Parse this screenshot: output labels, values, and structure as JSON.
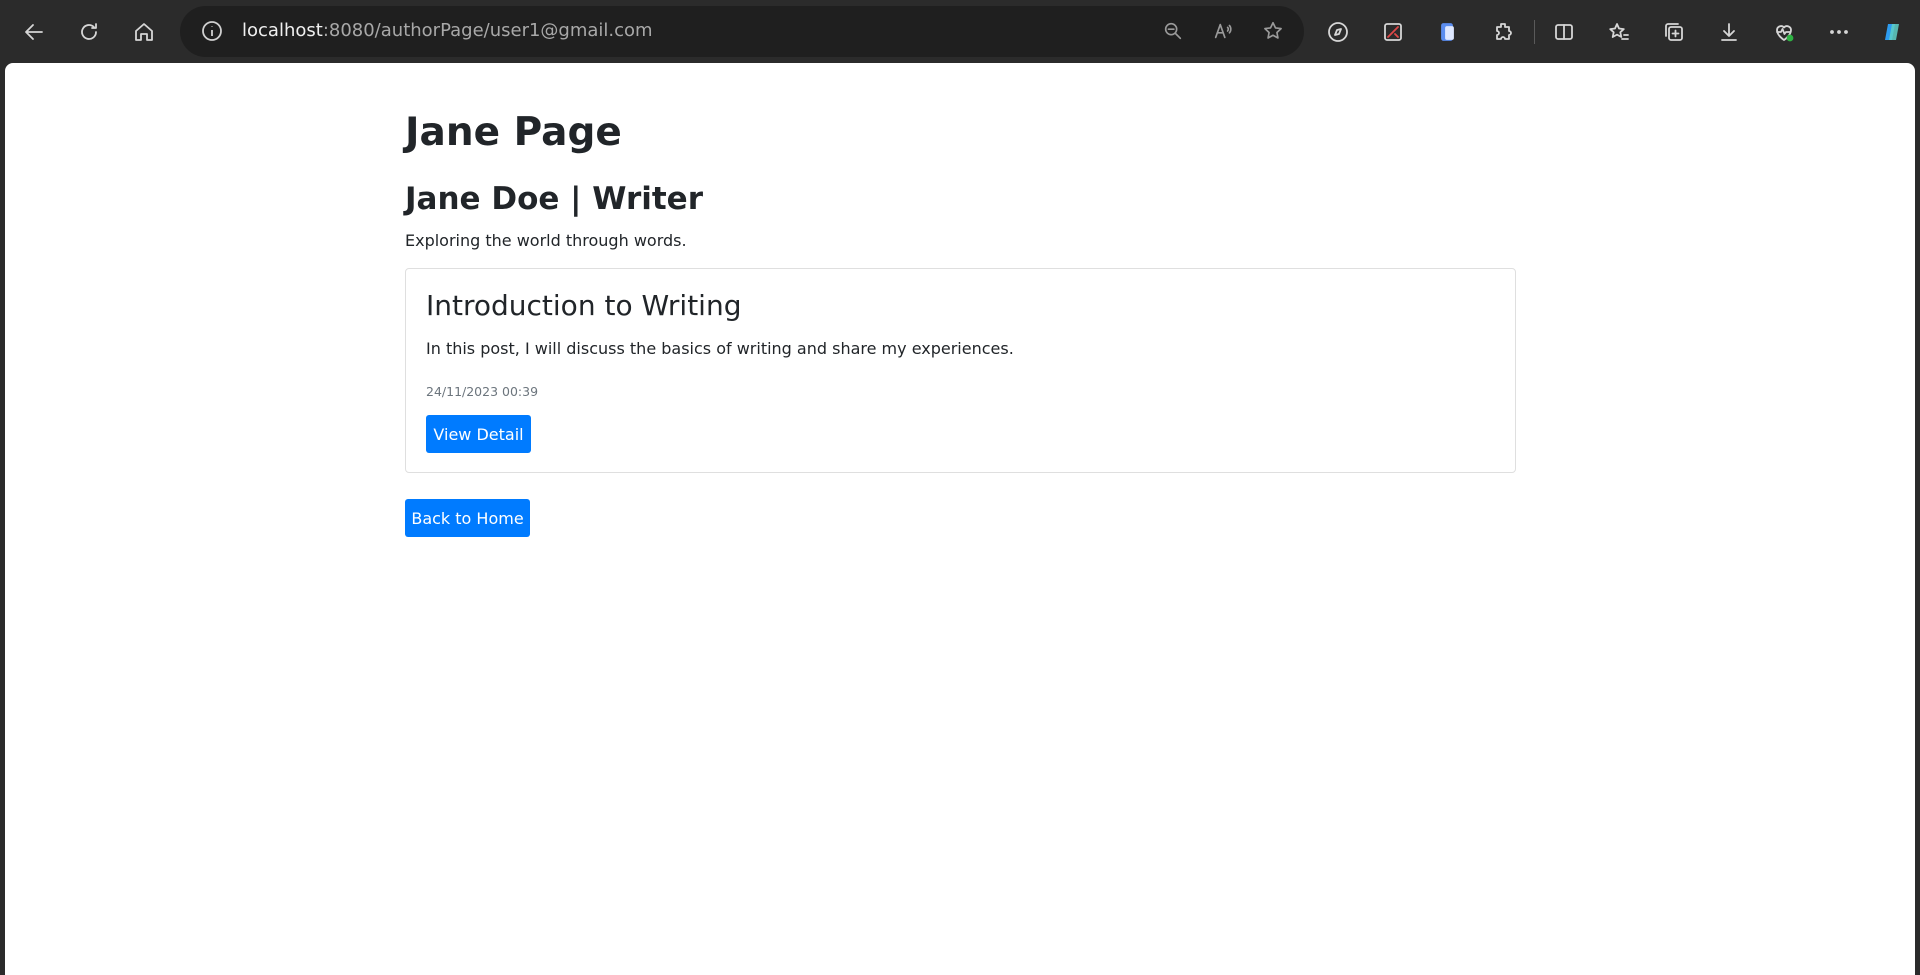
{
  "browser": {
    "url_host": "localhost",
    "url_rest": ":8080/authorPage/user1@gmail.com"
  },
  "page": {
    "title": "Jane Page",
    "author_heading": "Jane Doe | Writer",
    "bio": "Exploring the world through words."
  },
  "posts": [
    {
      "title": "Introduction to Writing",
      "excerpt": "In this post, I will discuss the basics of writing and share my experiences.",
      "date": "24/11/2023 00:39",
      "button_label": "View Detail"
    }
  ],
  "footer": {
    "back_button_label": "Back to Home"
  },
  "colors": {
    "primary_button": "#007bff",
    "text": "#212529",
    "muted": "#6c757d"
  }
}
